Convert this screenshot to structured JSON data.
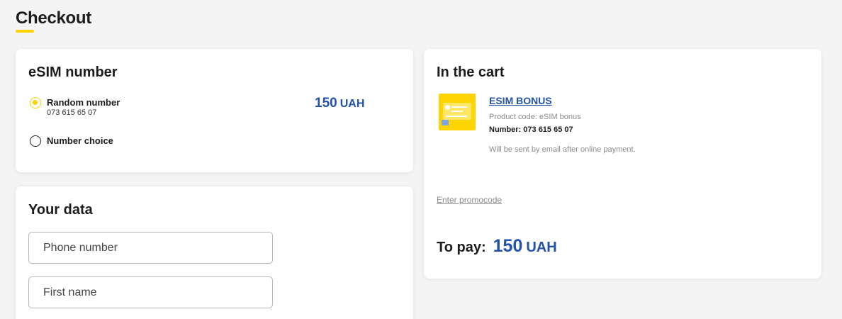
{
  "page": {
    "title": "Checkout"
  },
  "esim": {
    "heading": "eSIM number",
    "options": [
      {
        "label": "Random number",
        "sub": "073 615 65 07",
        "selected": true
      },
      {
        "label": "Number choice",
        "selected": false
      }
    ],
    "price_value": "150",
    "price_currency": "UAH"
  },
  "your_data": {
    "heading": "Your data",
    "phone_placeholder": "Phone number",
    "first_name_placeholder": "First name"
  },
  "cart": {
    "heading": "In the cart",
    "product": {
      "title": "ESIM BONUS",
      "code": "Product code: eSIM bonus",
      "number": "Number: 073 615 65 07",
      "note": "Will be sent by email after online payment."
    },
    "promo_link": "Enter promocode",
    "to_pay_label": "To pay:",
    "to_pay_value": "150",
    "to_pay_currency": "UAH"
  },
  "colors": {
    "accent_yellow": "#ffd400",
    "price_blue": "#2452a8",
    "background": "#f4f4f4"
  }
}
